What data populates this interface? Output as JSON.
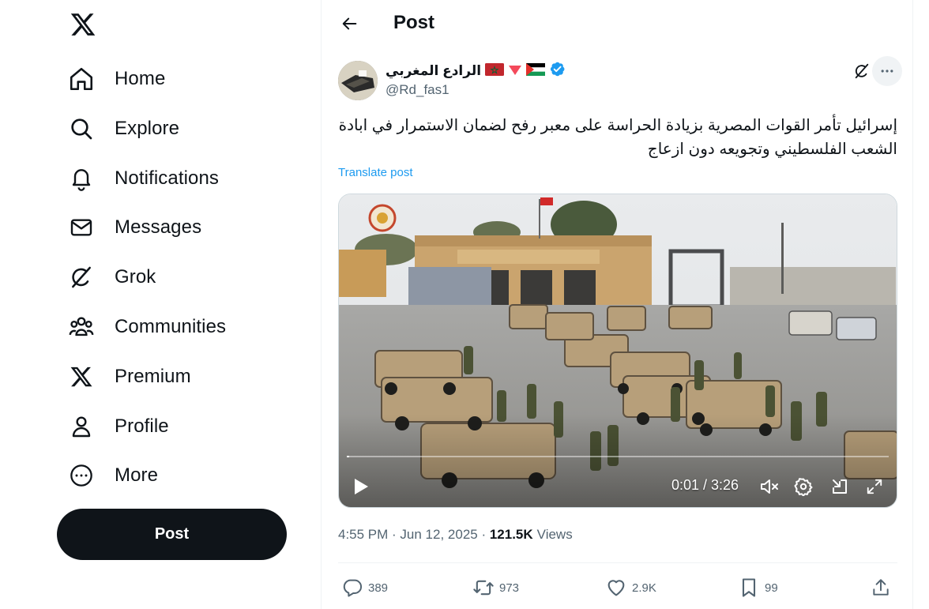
{
  "sidebar": {
    "logo_icon": "x-logo-icon",
    "items": [
      {
        "label": "Home",
        "icon": "home-icon"
      },
      {
        "label": "Explore",
        "icon": "search-icon"
      },
      {
        "label": "Notifications",
        "icon": "bell-icon"
      },
      {
        "label": "Messages",
        "icon": "envelope-icon"
      },
      {
        "label": "Grok",
        "icon": "grok-icon"
      },
      {
        "label": "Communities",
        "icon": "people-icon"
      },
      {
        "label": "Premium",
        "icon": "x-logo-icon"
      },
      {
        "label": "Profile",
        "icon": "person-icon"
      },
      {
        "label": "More",
        "icon": "more-circle-icon"
      }
    ],
    "post_button": "Post"
  },
  "header": {
    "title": "Post"
  },
  "post": {
    "author_name": "الرادع المغربي",
    "author_handle": "@Rd_fas1",
    "verified": true,
    "text": "إسرائيل تأمر القوات المصرية بزيادة الحراسة على معبر رفح لضمان الاستمرار في ابادة الشعب الفلسطيني وتجويعه دون ازعاج",
    "translate_label": "Translate post",
    "video": {
      "time": "0:01 / 3:26",
      "progress": 0.005,
      "muted": true
    },
    "timestamp": "4:55 PM · Jun 12, 2025",
    "views_count": "121.5K",
    "views_label": "Views",
    "replies": "389",
    "reposts": "973",
    "likes": "2.9K",
    "bookmarks": "99"
  },
  "colors": {
    "accent": "#1d9bf0",
    "text": "#0f1419",
    "secondary": "#536471",
    "verified": "#1d9bf0"
  }
}
